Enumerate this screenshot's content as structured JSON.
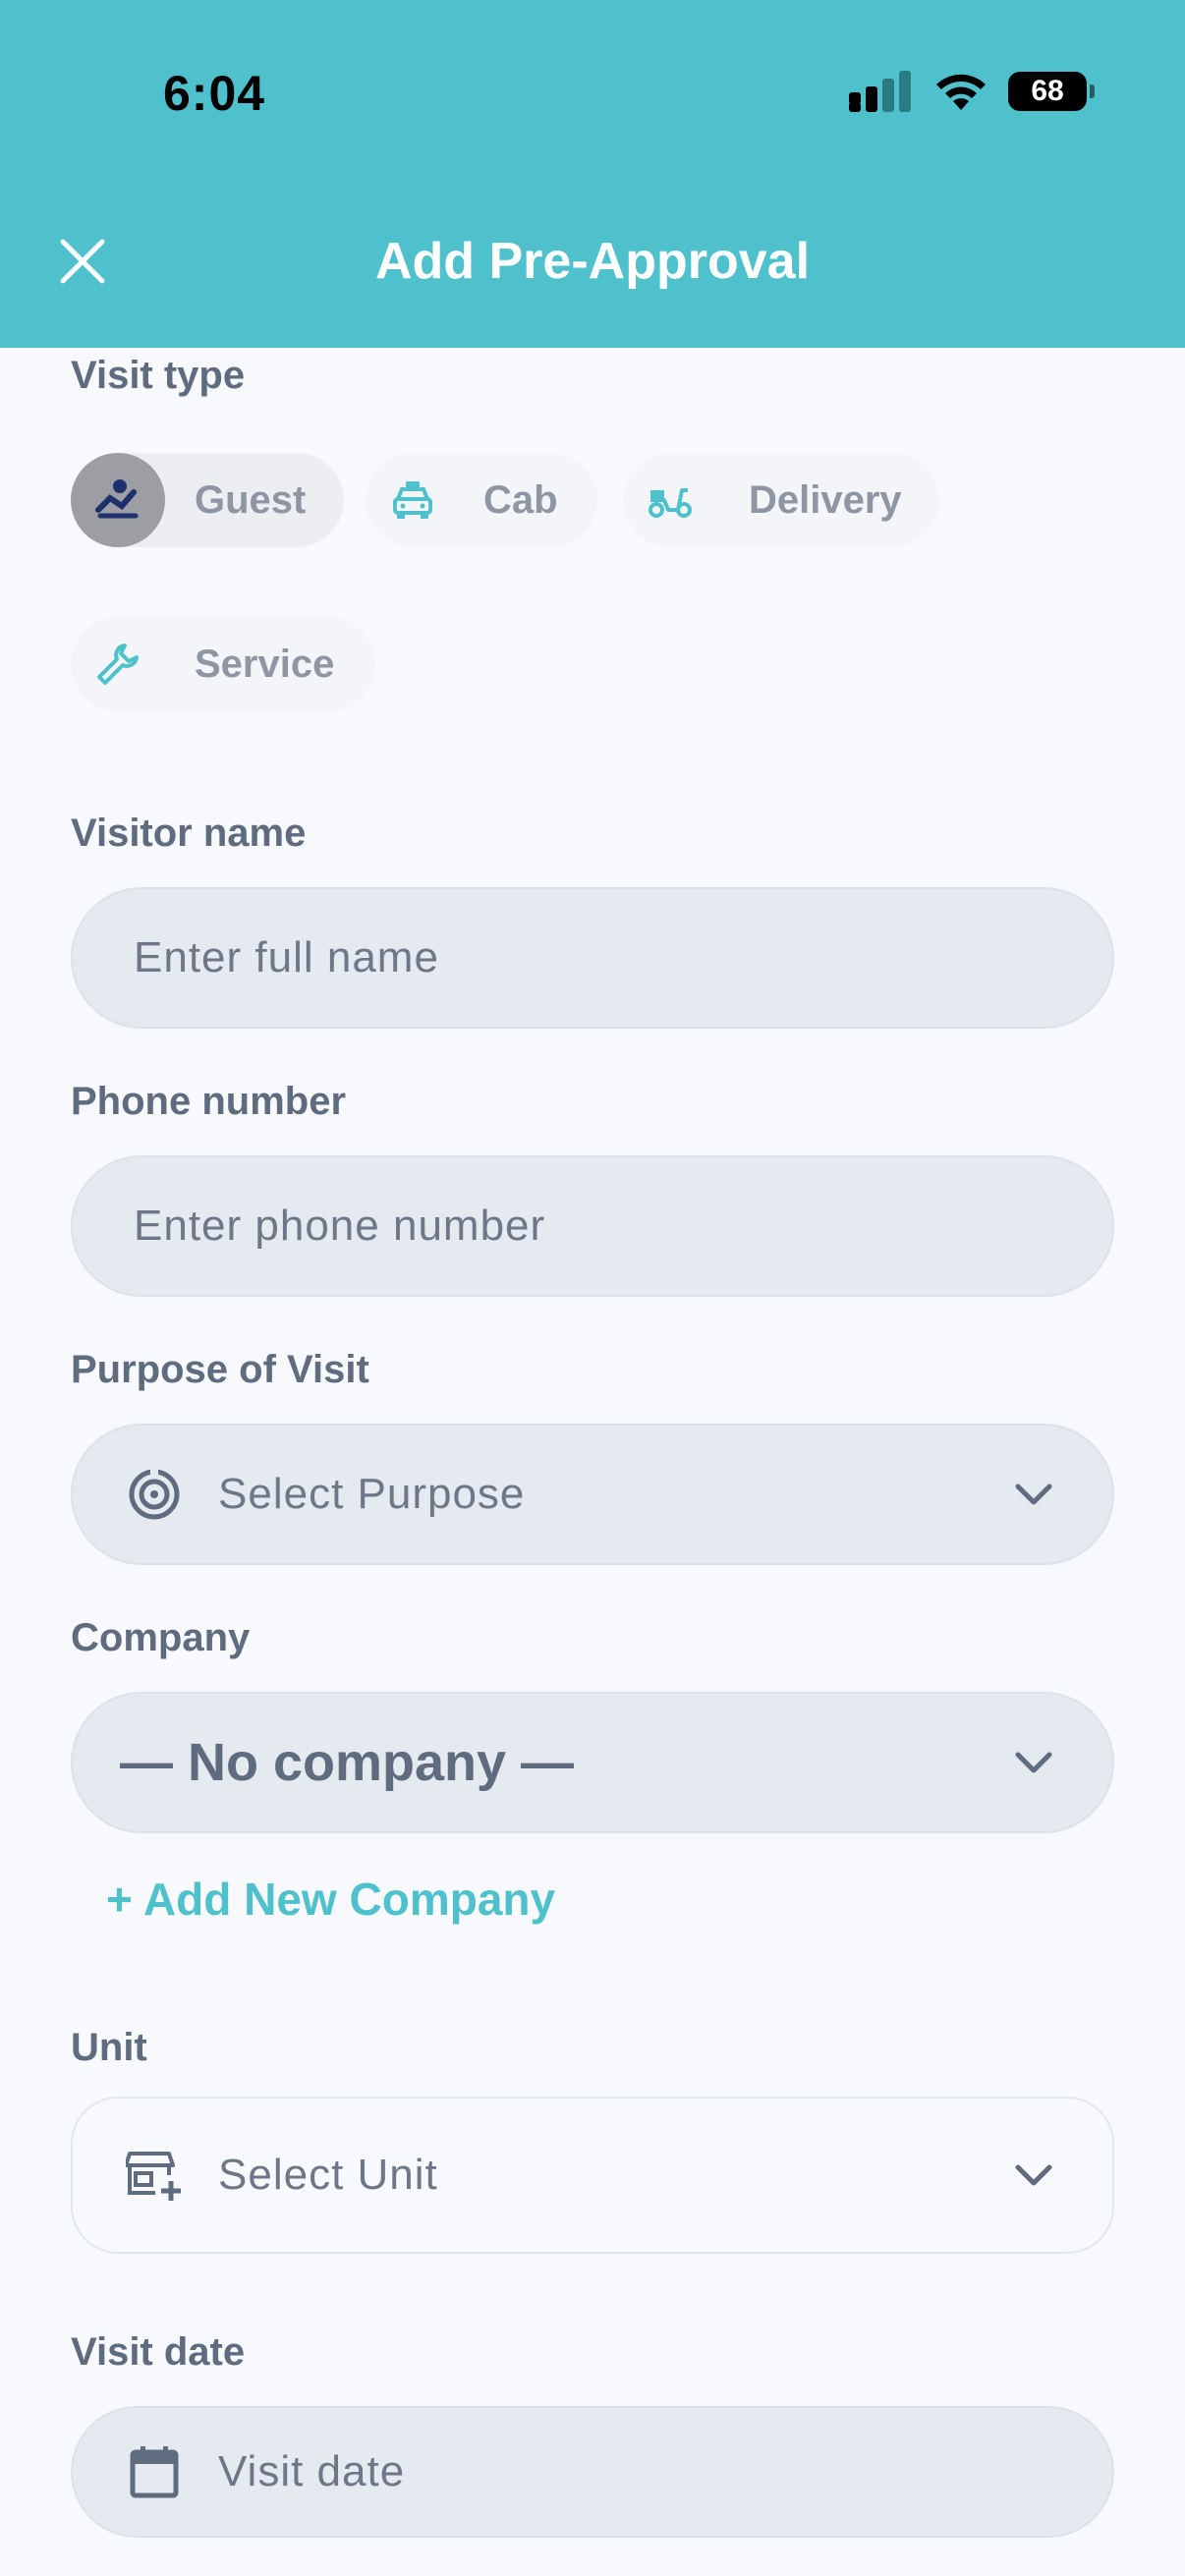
{
  "status_bar": {
    "time": "6:04",
    "battery": "68"
  },
  "header": {
    "title": "Add Pre-Approval"
  },
  "visit_type": {
    "label": "Visit type",
    "options": [
      {
        "label": "Guest",
        "icon": "guest-icon",
        "selected": true
      },
      {
        "label": "Cab",
        "icon": "taxi-icon",
        "selected": false
      },
      {
        "label": "Delivery",
        "icon": "scooter-icon",
        "selected": false
      },
      {
        "label": "Service",
        "icon": "wrench-icon",
        "selected": false
      }
    ]
  },
  "visitor_name": {
    "label": "Visitor name",
    "placeholder": "Enter full name"
  },
  "phone_number": {
    "label": "Phone number",
    "placeholder": "Enter phone number"
  },
  "purpose": {
    "label": "Purpose of Visit",
    "placeholder": "Select Purpose"
  },
  "company": {
    "label": "Company",
    "value": "— No company —",
    "add_link": "+ Add New Company"
  },
  "unit": {
    "label": "Unit",
    "placeholder": "Select Unit"
  },
  "visit_date": {
    "label": "Visit date",
    "placeholder": "Visit date"
  },
  "colors": {
    "accent": "#4fc1cc",
    "selected_chip_icon_bg": "#9c9ea3",
    "field_bg": "#e5e9f0"
  }
}
